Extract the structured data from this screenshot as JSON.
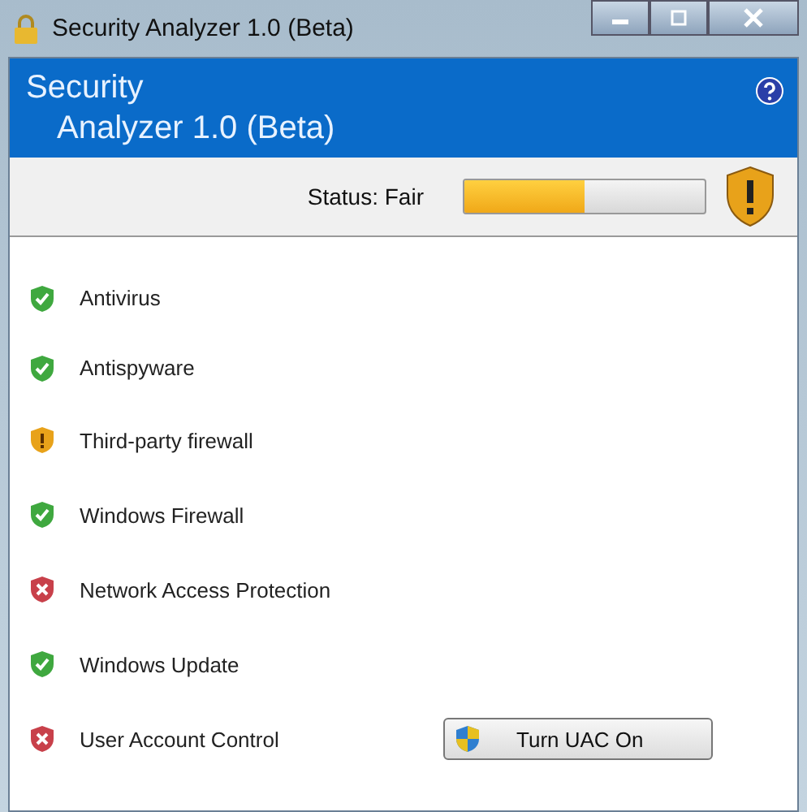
{
  "window": {
    "title": "Security Analyzer 1.0 (Beta)"
  },
  "header": {
    "title_line_1": "Security",
    "title_line_2": "Analyzer 1.0 (Beta)"
  },
  "status": {
    "label": "Status: Fair",
    "level": 0.5,
    "kind": "warning"
  },
  "checks": [
    {
      "label": "Antivirus",
      "kind": "ok"
    },
    {
      "label": "Antispyware",
      "kind": "ok"
    },
    {
      "label": "Third-party firewall",
      "kind": "warning"
    },
    {
      "label": "Windows Firewall",
      "kind": "ok"
    },
    {
      "label": "Network Access Protection",
      "kind": "error"
    },
    {
      "label": "Windows Update",
      "kind": "ok"
    },
    {
      "label": "User Account Control",
      "kind": "error",
      "button": "Turn UAC On"
    }
  ]
}
